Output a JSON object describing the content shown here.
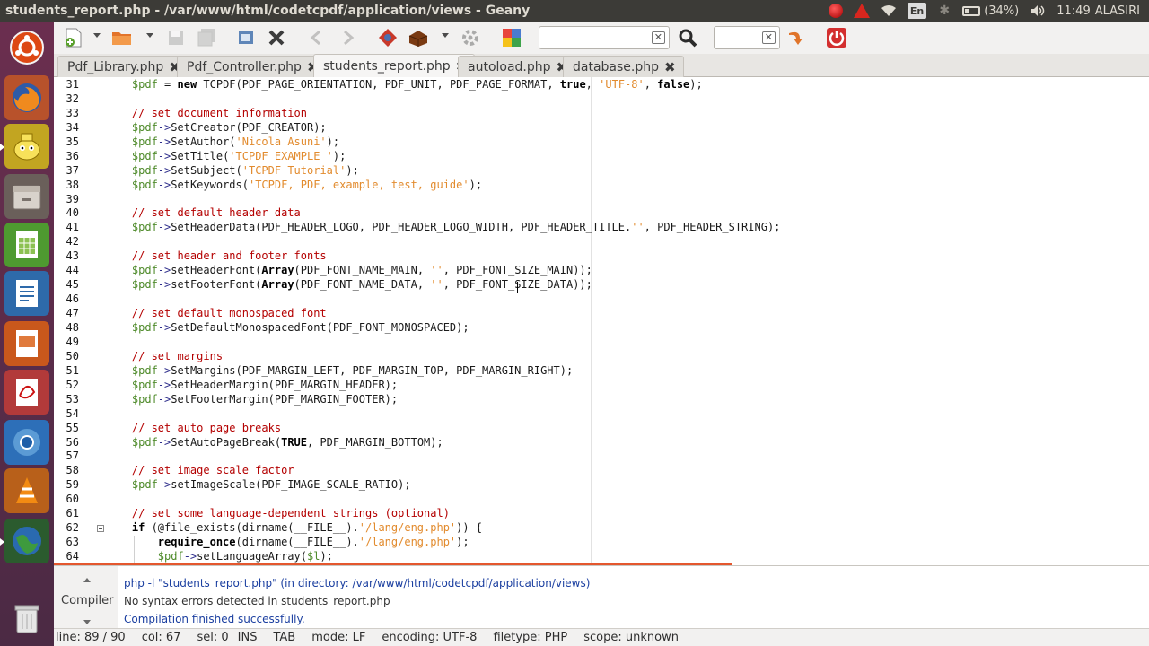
{
  "window": {
    "title": "students_report.php - /var/www/html/codetcpdf/application/views - Geany"
  },
  "tray": {
    "keyboard_layout": "En",
    "battery": "(34%)",
    "clock": "11:49",
    "user": "ALASIRI"
  },
  "launcher": {
    "items": [
      {
        "name": "ubuntu-dash-icon"
      },
      {
        "name": "firefox-icon"
      },
      {
        "name": "geany-icon"
      },
      {
        "name": "files-icon"
      },
      {
        "name": "libreoffice-calc-icon"
      },
      {
        "name": "libreoffice-writer-icon"
      },
      {
        "name": "libreoffice-impress-icon"
      },
      {
        "name": "document-viewer-icon"
      },
      {
        "name": "chromium-icon"
      },
      {
        "name": "vlc-icon"
      },
      {
        "name": "globe-app-icon"
      },
      {
        "name": "trash-icon"
      }
    ]
  },
  "toolbar": {
    "search_value": "",
    "goto_value": ""
  },
  "tabs": [
    {
      "label": "Pdf_Library.php",
      "active": false
    },
    {
      "label": "Pdf_Controller.php",
      "active": false
    },
    {
      "label": "students_report.php",
      "active": true
    },
    {
      "label": "autoload.php",
      "active": false
    },
    {
      "label": "database.php",
      "active": false
    }
  ],
  "editor": {
    "lines": [
      {
        "n": "31",
        "text": "    $pdf = new TCPDF(PDF_PAGE_ORIENTATION, PDF_UNIT, PDF_PAGE_FORMAT, true, 'UTF-8', false);"
      },
      {
        "n": "32",
        "text": ""
      },
      {
        "n": "33",
        "text": "    // set document information"
      },
      {
        "n": "34",
        "text": "    $pdf->SetCreator(PDF_CREATOR);"
      },
      {
        "n": "35",
        "text": "    $pdf->SetAuthor('Nicola Asuni');"
      },
      {
        "n": "36",
        "text": "    $pdf->SetTitle('TCPDF EXAMPLE ');"
      },
      {
        "n": "37",
        "text": "    $pdf->SetSubject('TCPDF Tutorial');"
      },
      {
        "n": "38",
        "text": "    $pdf->SetKeywords('TCPDF, PDF, example, test, guide');"
      },
      {
        "n": "39",
        "text": ""
      },
      {
        "n": "40",
        "text": "    // set default header data"
      },
      {
        "n": "41",
        "text": "    $pdf->SetHeaderData(PDF_HEADER_LOGO, PDF_HEADER_LOGO_WIDTH, PDF_HEADER_TITLE.'', PDF_HEADER_STRING);"
      },
      {
        "n": "42",
        "text": ""
      },
      {
        "n": "43",
        "text": "    // set header and footer fonts"
      },
      {
        "n": "44",
        "text": "    $pdf->setHeaderFont(Array(PDF_FONT_NAME_MAIN, '', PDF_FONT_SIZE_MAIN));"
      },
      {
        "n": "45",
        "text": "    $pdf->setFooterFont(Array(PDF_FONT_NAME_DATA, '', PDF_FONT_SIZE_DATA));"
      },
      {
        "n": "46",
        "text": ""
      },
      {
        "n": "47",
        "text": "    // set default monospaced font"
      },
      {
        "n": "48",
        "text": "    $pdf->SetDefaultMonospacedFont(PDF_FONT_MONOSPACED);"
      },
      {
        "n": "49",
        "text": ""
      },
      {
        "n": "50",
        "text": "    // set margins"
      },
      {
        "n": "51",
        "text": "    $pdf->SetMargins(PDF_MARGIN_LEFT, PDF_MARGIN_TOP, PDF_MARGIN_RIGHT);"
      },
      {
        "n": "52",
        "text": "    $pdf->SetHeaderMargin(PDF_MARGIN_HEADER);"
      },
      {
        "n": "53",
        "text": "    $pdf->SetFooterMargin(PDF_MARGIN_FOOTER);"
      },
      {
        "n": "54",
        "text": ""
      },
      {
        "n": "55",
        "text": "    // set auto page breaks"
      },
      {
        "n": "56",
        "text": "    $pdf->SetAutoPageBreak(TRUE, PDF_MARGIN_BOTTOM);"
      },
      {
        "n": "57",
        "text": ""
      },
      {
        "n": "58",
        "text": "    // set image scale factor"
      },
      {
        "n": "59",
        "text": "    $pdf->setImageScale(PDF_IMAGE_SCALE_RATIO);"
      },
      {
        "n": "60",
        "text": ""
      },
      {
        "n": "61",
        "text": "    // set some language-dependent strings (optional)"
      },
      {
        "n": "62",
        "text": "    if (@file_exists(dirname(__FILE__).'/lang/eng.php')) {"
      },
      {
        "n": "63",
        "text": "        require_once(dirname(__FILE__).'/lang/eng.php');"
      },
      {
        "n": "64",
        "text": "        $pdf->setLanguageArray($l);"
      }
    ]
  },
  "messages": {
    "tab_label": "Compiler",
    "lines": [
      {
        "text": "php -l \"students_report.php\" (in directory: /var/www/html/codetcpdf/application/views)",
        "color": "#1b3fa0"
      },
      {
        "text": "No syntax errors detected in students_report.php",
        "color": "#333333"
      },
      {
        "text": "Compilation finished successfully.",
        "color": "#1b3fa0"
      }
    ]
  },
  "status": {
    "line": "line: 89 / 90",
    "col": "col: 67",
    "sel": "sel: 0",
    "ins": "INS",
    "tab": "TAB",
    "mode": "mode: LF",
    "encoding": "encoding: UTF-8",
    "filetype": "filetype: PHP",
    "scope": "scope: unknown"
  },
  "colors": {
    "comment": "#b40000",
    "variable": "#4f8b2b",
    "string": "#e28b2e",
    "scrollbar_accent": "#e4572e"
  }
}
